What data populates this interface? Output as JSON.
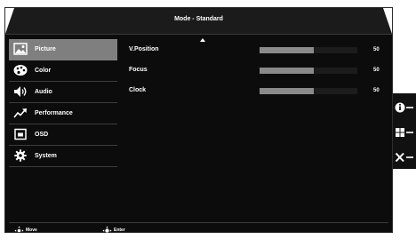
{
  "header": {
    "title": "Mode - Standard"
  },
  "sidebar": {
    "items": [
      {
        "label": "Picture",
        "icon": "picture-icon",
        "active": true
      },
      {
        "label": "Color",
        "icon": "palette-icon",
        "active": false
      },
      {
        "label": "Audio",
        "icon": "speaker-icon",
        "active": false
      },
      {
        "label": "Performance",
        "icon": "trend-arrow-icon",
        "active": false
      },
      {
        "label": "OSD",
        "icon": "osd-window-icon",
        "active": false
      },
      {
        "label": "System",
        "icon": "gear-icon",
        "active": false
      }
    ]
  },
  "settings": [
    {
      "label": "V.Position",
      "value": "50",
      "level": 0.55
    },
    {
      "label": "Focus",
      "value": "50",
      "level": 0.55
    },
    {
      "label": "Clock",
      "value": "50",
      "level": 0.55
    }
  ],
  "footer": {
    "move_label": "Move",
    "enter_label": "Enter"
  },
  "hotkeys": [
    "info-icon",
    "grid-icon",
    "close-icon"
  ],
  "colors": {
    "background": "#0c0c0c",
    "active": "#7f7f7f",
    "fill": "#8a8a8a",
    "text": "#ffffff"
  }
}
